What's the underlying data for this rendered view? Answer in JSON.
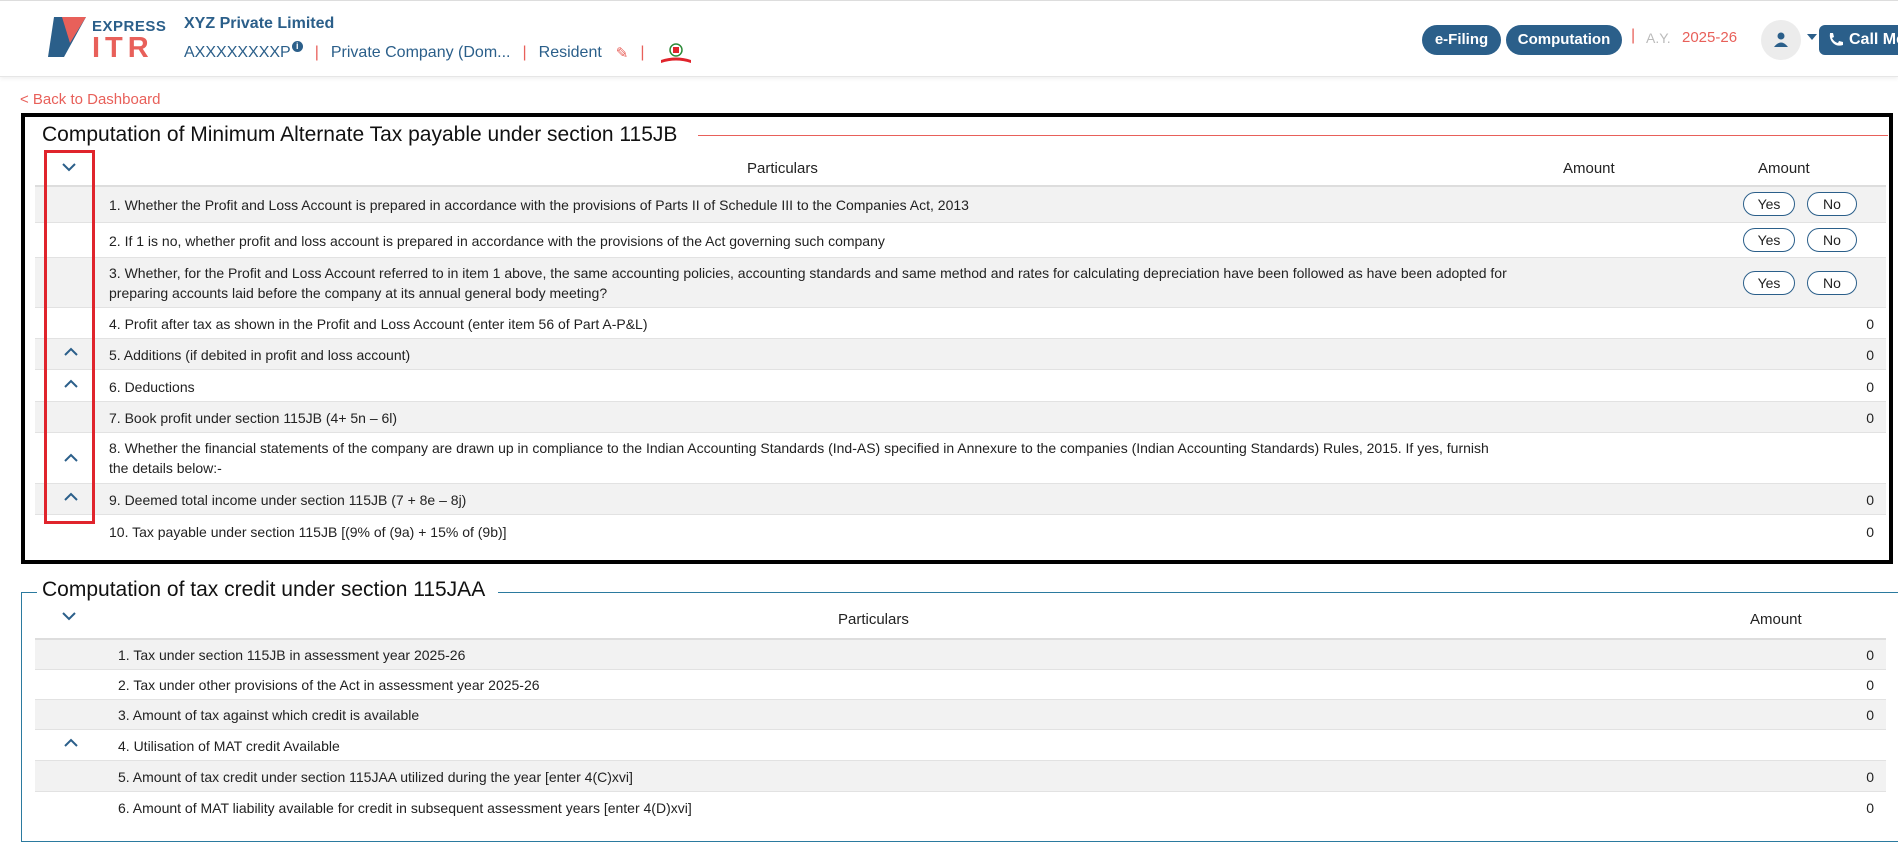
{
  "header": {
    "logo": {
      "express": "EXPRESS",
      "itr": "ITR"
    },
    "company_name": "XYZ Private Limited",
    "pan": "AXXXXXXXXP",
    "info_icon": "i",
    "separator": "|",
    "company_type": "Private Company (Dom...",
    "residency": "Resident",
    "pencil_icon": "✎",
    "emblem_icon": "emblem-icon",
    "efiling_label": "e-Filing",
    "computation_label": "Computation",
    "ay_separator": "|",
    "ay_label": "A.Y.",
    "ay_value": "2025-26",
    "call_label": "Call Me",
    "accent": "#2b5f8a",
    "highlight": "#e8605a"
  },
  "back_link": "< Back to Dashboard",
  "section1": {
    "title": "Computation of Minimum Alternate Tax payable under section 115JB",
    "col_particulars": "Particulars",
    "col_amount1": "Amount",
    "col_amount2": "Amount",
    "yes_label": "Yes",
    "no_label": "No",
    "rows": [
      {
        "text": "1.  Whether the Profit and Loss Account is prepared in accordance with the provisions of Parts II of Schedule III to the Companies Act, 2013",
        "amount": ""
      },
      {
        "text": "2.  If 1 is no, whether profit and loss account is prepared in accordance with the provisions of the Act governing such company",
        "amount": ""
      },
      {
        "text": "3.  Whether, for the Profit and Loss Account referred to in item 1 above, the same accounting policies, accounting standards and same method and rates for calculating depreciation have been followed as have been adopted for preparing accounts laid before the company at its annual general body meeting?",
        "amount": ""
      },
      {
        "text": "4.  Profit after tax as shown in the Profit and Loss Account (enter item 56 of Part A-P&L)",
        "amount": "0"
      },
      {
        "text": "5.  Additions (if debited in profit and loss account)",
        "amount": "0"
      },
      {
        "text": "6.  Deductions",
        "amount": "0"
      },
      {
        "text": "7.  Book profit under section 115JB (4+ 5n – 6l)",
        "amount": "0"
      },
      {
        "text": "8.  Whether the financial statements of the company are drawn up in compliance to the Indian Accounting Standards (Ind-AS) specified in Annexure to the companies (Indian Accounting Standards) Rules, 2015. If yes, furnish the details below:-",
        "amount": ""
      },
      {
        "text": "9.  Deemed total income under section 115JB (7 + 8e – 8j)",
        "amount": "0"
      },
      {
        "text": "10.  Tax payable under section 115JB [(9% of (9a) + 15% of (9b)]",
        "amount": "0"
      }
    ]
  },
  "section2": {
    "title": "Computation of tax credit under section 115JAA",
    "col_particulars": "Particulars",
    "col_amount": "Amount",
    "rows": [
      {
        "text": "1.   Tax under section 115JB in assessment year 2025-26",
        "amount": "0"
      },
      {
        "text": "2.   Tax under other provisions of the Act in assessment year 2025-26",
        "amount": "0"
      },
      {
        "text": "3.   Amount of tax against which credit is available",
        "amount": "0"
      },
      {
        "text": "4.   Utilisation of MAT credit Available",
        "amount": ""
      },
      {
        "text": "5.   Amount of tax credit under section 115JAA utilized during the year [enter 4(C)xvi]",
        "amount": "0"
      },
      {
        "text": "6.   Amount of MAT liability available for credit in subsequent assessment years [enter 4(D)xvi]",
        "amount": "0"
      }
    ]
  }
}
